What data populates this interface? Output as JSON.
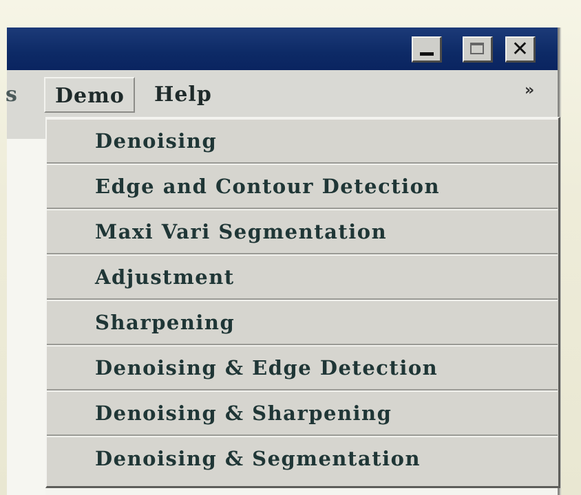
{
  "window": {
    "controls": {
      "minimize_icon": "minimize-icon",
      "maximize_icon": "maximize-icon",
      "close_icon": "close-icon",
      "close_glyph": "✕"
    }
  },
  "menubar": {
    "partial_label": "s",
    "items": [
      {
        "label": "Demo"
      },
      {
        "label": "Help"
      }
    ],
    "overflow_icon": "chevron-icon",
    "overflow_glyph": "»"
  },
  "dropdown": {
    "items": [
      {
        "label": "Denoising"
      },
      {
        "label": "Edge and Contour Detection"
      },
      {
        "label": "Maxi Vari Segmentation"
      },
      {
        "label": "Adjustment"
      },
      {
        "label": "Sharpening"
      },
      {
        "label": "Denoising & Edge Detection"
      },
      {
        "label": "Denoising & Sharpening"
      },
      {
        "label": "Denoising & Segmentation"
      }
    ]
  },
  "colors": {
    "titlebar": "#0d2a66",
    "menu_face": "#d9d9d4",
    "menu_text": "#1e2a2a"
  }
}
